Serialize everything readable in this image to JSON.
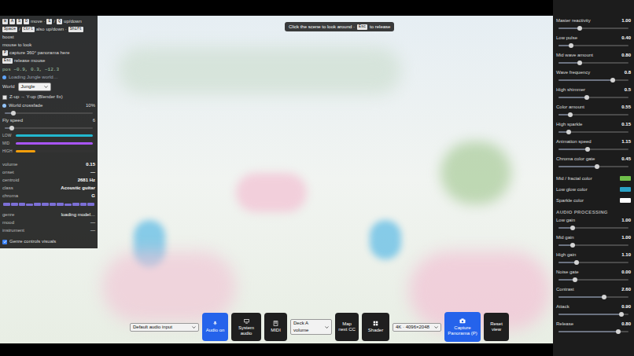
{
  "hint": {
    "before": "Click the scene to look around ·",
    "key": "Esc",
    "after": "to release"
  },
  "help": [
    {
      "segments": [
        {
          "kind": "key",
          "text": "W"
        },
        {
          "kind": "key",
          "text": "A"
        },
        {
          "kind": "key",
          "text": "S"
        },
        {
          "kind": "key",
          "text": "D"
        },
        {
          "kind": "text",
          "text": "move ·"
        },
        {
          "kind": "key",
          "text": "E"
        },
        {
          "kind": "text",
          "text": "/"
        },
        {
          "kind": "key",
          "text": "Q"
        },
        {
          "kind": "text",
          "text": "up/down"
        }
      ]
    },
    {
      "segments": [
        {
          "kind": "key",
          "text": "Space"
        },
        {
          "kind": "text",
          "text": "/"
        },
        {
          "kind": "key",
          "text": "Ctrl"
        },
        {
          "kind": "text",
          "text": "also up/down ·"
        },
        {
          "kind": "key",
          "text": "Shift"
        },
        {
          "kind": "text",
          "text": "boost"
        }
      ]
    },
    {
      "segments": [
        {
          "kind": "text",
          "text": "mouse to look"
        }
      ]
    },
    {
      "segments": [
        {
          "kind": "key",
          "text": "P"
        },
        {
          "kind": "text",
          "text": "capture 360° panorama here"
        }
      ]
    },
    {
      "segments": [
        {
          "kind": "key",
          "text": "Esc"
        },
        {
          "kind": "text",
          "text": "release mouse"
        }
      ]
    }
  ],
  "position": "pos −0.9, 0.3, −12.3",
  "status": {
    "text": "Loading Jungle world…",
    "color": "#60a5fa"
  },
  "world": {
    "label": "World",
    "value": "Jungle"
  },
  "zup": {
    "label": "Z-up → Y-up (Blender fix)",
    "checked": false
  },
  "crossfade": {
    "label": "World crossfade",
    "value": "10%",
    "level": 0.1
  },
  "fly": {
    "label": "Fly speed",
    "value": "6",
    "level": 0.08
  },
  "bands": [
    {
      "label": "LOW",
      "level": 0.97,
      "color": "#22b8cf"
    },
    {
      "label": "MID",
      "level": 0.97,
      "color": "#a855f7"
    },
    {
      "label": "HIGH",
      "level": 0.25,
      "color": "#f59e0b"
    }
  ],
  "metrics": [
    {
      "label": "volume",
      "value": "0.15"
    },
    {
      "label": "onset",
      "value": "—"
    },
    {
      "label": "centroid",
      "value": "2681 Hz"
    },
    {
      "label": "class",
      "value": "Acoustic guitar"
    }
  ],
  "chroma": {
    "label": "chroma",
    "value": "G",
    "bars": [
      0.6,
      0.55,
      0.6,
      0.5,
      0.62,
      0.55,
      0.6,
      0.58,
      0.5,
      0.55,
      0.6,
      0.6
    ]
  },
  "info": [
    {
      "label": "genre",
      "value": "loading model…"
    },
    {
      "label": "mood",
      "value": "—"
    },
    {
      "label": "instrument",
      "value": "—"
    }
  ],
  "genre_controls": {
    "label": "Genre controls visuals",
    "checked": true
  },
  "controls": [
    {
      "kind": "slider",
      "label": "Master reactivity",
      "value": "1.00",
      "level": 0.3
    },
    {
      "kind": "slider",
      "label": "Low pulse",
      "value": "0.40",
      "level": 0.18
    },
    {
      "kind": "slider",
      "label": "Mid wave amount",
      "value": "0.80",
      "level": 0.3
    },
    {
      "kind": "slider",
      "label": "Wave frequency",
      "value": "0.8",
      "level": 0.78
    },
    {
      "kind": "slider",
      "label": "High shimmer",
      "value": "0.5",
      "level": 0.4
    },
    {
      "kind": "slider",
      "label": "Color amount",
      "value": "0.55",
      "level": 0.17
    },
    {
      "kind": "slider",
      "label": "High sparkle",
      "value": "0.15",
      "level": 0.15
    },
    {
      "kind": "slider",
      "label": "Animation speed",
      "value": "1.15",
      "level": 0.42
    },
    {
      "kind": "slider",
      "label": "Chroma color gate",
      "value": "0.45",
      "level": 0.55
    },
    {
      "kind": "color",
      "label": "Mid / fractal color",
      "color": "#6fbf4a"
    },
    {
      "kind": "color",
      "label": "Low glow color",
      "color": "#2aa3c7"
    },
    {
      "kind": "color",
      "label": "Sparkle color",
      "color": "#ffffff"
    },
    {
      "kind": "header",
      "label": "AUDIO PROCESSING"
    },
    {
      "kind": "slider",
      "label": "Low gain",
      "value": "1.00",
      "level": 0.2
    },
    {
      "kind": "slider",
      "label": "Mid gain",
      "value": "1.00",
      "level": 0.2
    },
    {
      "kind": "slider",
      "label": "High gain",
      "value": "1.10",
      "level": 0.26
    },
    {
      "kind": "slider",
      "label": "Noise gate",
      "value": "0.00",
      "level": 0.24
    },
    {
      "kind": "slider",
      "label": "Contrast",
      "value": "2.60",
      "level": 0.65
    },
    {
      "kind": "slider",
      "label": "Attack",
      "value": "0.90",
      "level": 0.9
    },
    {
      "kind": "slider",
      "label": "Release",
      "value": "0.80",
      "level": 0.85
    }
  ],
  "toolbar": {
    "input": "Default audio input",
    "audio": {
      "label": "Audio on",
      "highlighted": true
    },
    "system": {
      "label": "System audio",
      "highlighted": false
    },
    "midi": {
      "label": "MIDI",
      "highlighted": false
    },
    "deck": "Deck A volume",
    "map": {
      "label": "Map next CC",
      "highlighted": false
    },
    "shader": {
      "label": "Shader",
      "highlighted": false
    },
    "resolution": "4K · 4096×2048",
    "capture": {
      "label": "Capture Panorama (P)",
      "highlighted": true
    },
    "reset": {
      "label": "Reset view",
      "highlighted": false
    }
  }
}
